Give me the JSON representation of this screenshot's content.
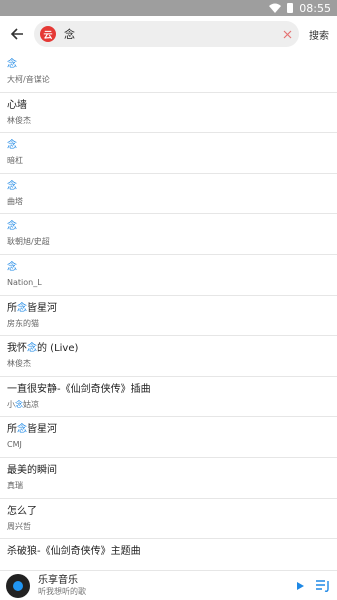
{
  "status": {
    "time": "08:55"
  },
  "search": {
    "query": "念",
    "app_icon_text": "云",
    "search_button": "搜索"
  },
  "results": [
    {
      "title_pre": "",
      "title_hl": "念",
      "title_post": "",
      "artist_pre": "大柯/音谋论",
      "artist_hl": "",
      "artist_post": ""
    },
    {
      "title_pre": "心墙",
      "title_hl": "",
      "title_post": "",
      "artist_pre": "林俊杰",
      "artist_hl": "",
      "artist_post": ""
    },
    {
      "title_pre": "",
      "title_hl": "念",
      "title_post": "",
      "artist_pre": "暗杠",
      "artist_hl": "",
      "artist_post": ""
    },
    {
      "title_pre": "",
      "title_hl": "念",
      "title_post": "",
      "artist_pre": "曲塔",
      "artist_hl": "",
      "artist_post": ""
    },
    {
      "title_pre": "",
      "title_hl": "念",
      "title_post": "",
      "artist_pre": "耿朝旭/史超",
      "artist_hl": "",
      "artist_post": ""
    },
    {
      "title_pre": "",
      "title_hl": "念",
      "title_post": "",
      "artist_pre": "Nation_L",
      "artist_hl": "",
      "artist_post": ""
    },
    {
      "title_pre": "所",
      "title_hl": "念",
      "title_post": "皆星河",
      "artist_pre": "房东的猫",
      "artist_hl": "",
      "artist_post": ""
    },
    {
      "title_pre": "我怀",
      "title_hl": "念",
      "title_post": "的 (Live)",
      "artist_pre": "林俊杰",
      "artist_hl": "",
      "artist_post": ""
    },
    {
      "title_pre": "一直很安静-《仙剑奇侠传》插曲",
      "title_hl": "",
      "title_post": "",
      "artist_pre": "小",
      "artist_hl": "念",
      "artist_post": "姑凉"
    },
    {
      "title_pre": "所",
      "title_hl": "念",
      "title_post": "皆星河",
      "artist_pre": "CMJ",
      "artist_hl": "",
      "artist_post": ""
    },
    {
      "title_pre": "最美的瞬间",
      "title_hl": "",
      "title_post": "",
      "artist_pre": "真瑞",
      "artist_hl": "",
      "artist_post": ""
    },
    {
      "title_pre": "怎么了",
      "title_hl": "",
      "title_post": "",
      "artist_pre": "周兴哲",
      "artist_hl": "",
      "artist_post": ""
    },
    {
      "title_pre": "杀破狼-《仙剑奇侠传》主题曲",
      "title_hl": "",
      "title_post": "",
      "artist_pre": "",
      "artist_hl": "",
      "artist_post": ""
    }
  ],
  "player": {
    "name": "乐享音乐",
    "subtitle": "听我想听的歌"
  },
  "colors": {
    "accent": "#1e88e5",
    "statusbar": "#9e9e9e"
  },
  "icons": [
    "back-arrow-icon",
    "netease-app-icon",
    "clear-icon",
    "wifi-icon",
    "battery-icon",
    "play-icon",
    "playlist-icon",
    "disc-icon"
  ]
}
